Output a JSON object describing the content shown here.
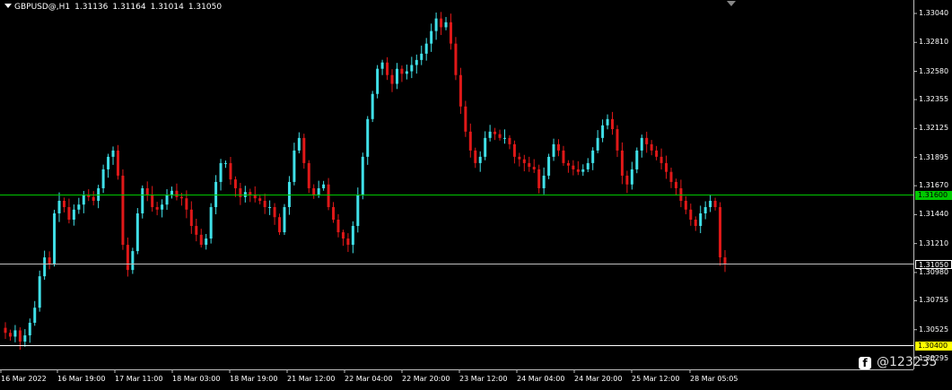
{
  "header": {
    "symbol": "GBPUSD@,H1",
    "open": "1.31136",
    "high": "1.31164",
    "low": "1.31014",
    "close": "1.31050"
  },
  "price_axis": {
    "labels": [
      "1.33040",
      "1.32810",
      "1.32580",
      "1.32355",
      "1.32125",
      "1.31895",
      "1.31670",
      "1.31440",
      "1.31210",
      "1.30980",
      "1.30755",
      "1.30525",
      "1.30295"
    ],
    "tick_values": [
      1.3304,
      1.3281,
      1.3258,
      1.32355,
      1.32125,
      1.31895,
      1.3167,
      1.3144,
      1.3121,
      1.3098,
      1.30755,
      1.30525,
      1.30295
    ]
  },
  "horizontal_lines": [
    {
      "label": "1.31600",
      "value": 1.316,
      "line_color": "#00c800",
      "tag_color": "#00c800"
    },
    {
      "label": "1.31050",
      "value": 1.3105,
      "line_color": "#c0c0c0",
      "tag_color": "#000000"
    },
    {
      "label": "1.30400",
      "value": 1.304,
      "line_color": "#ffffff",
      "tag_color": "#ffff00"
    }
  ],
  "time_axis": {
    "labels": [
      "16 Mar 2022",
      "16 Mar 19:00",
      "17 Mar 11:00",
      "18 Mar 03:00",
      "18 Mar 19:00",
      "21 Mar 12:00",
      "22 Mar 04:00",
      "22 Mar 20:00",
      "23 Mar 12:00",
      "24 Mar 04:00",
      "24 Mar 20:00",
      "25 Mar 12:00",
      "28 Mar 05:05"
    ]
  },
  "colors": {
    "background": "#000000",
    "bull_candle": "#40e0e8",
    "bear_candle": "#e01818",
    "axis": "#c0c0c0"
  },
  "watermark": {
    "icon": "facebook-icon",
    "text": "@123235"
  },
  "chart_data": {
    "type": "candlestick",
    "title": "GBPUSD@,H1",
    "ylim": [
      1.302,
      1.331
    ],
    "close_trajectory": [
      1.305,
      1.3047,
      1.3052,
      1.3043,
      1.3048,
      1.3058,
      1.307,
      1.3095,
      1.311,
      1.3105,
      1.3145,
      1.3155,
      1.315,
      1.314,
      1.3148,
      1.3152,
      1.316,
      1.3158,
      1.3155,
      1.3165,
      1.318,
      1.319,
      1.3195,
      1.3175,
      1.312,
      1.31,
      1.3115,
      1.3145,
      1.3165,
      1.316,
      1.315,
      1.3148,
      1.3152,
      1.316,
      1.3163,
      1.3158,
      1.3157,
      1.3148,
      1.3135,
      1.3128,
      1.312,
      1.3125,
      1.315,
      1.317,
      1.3185,
      1.3185,
      1.3172,
      1.3165,
      1.3158,
      1.3162,
      1.316,
      1.3157,
      1.3155,
      1.315,
      1.315,
      1.3142,
      1.313,
      1.315,
      1.317,
      1.3195,
      1.3205,
      1.3185,
      1.3165,
      1.316,
      1.3165,
      1.3168,
      1.315,
      1.314,
      1.313,
      1.3125,
      1.312,
      1.3135,
      1.316,
      1.319,
      1.322,
      1.324,
      1.326,
      1.3265,
      1.3255,
      1.3248,
      1.326,
      1.3256,
      1.3258,
      1.3263,
      1.3267,
      1.3272,
      1.328,
      1.329,
      1.33,
      1.3293,
      1.3297,
      1.328,
      1.3255,
      1.323,
      1.321,
      1.3195,
      1.3185,
      1.319,
      1.3205,
      1.321,
      1.3208,
      1.3205,
      1.3205,
      1.32,
      1.319,
      1.3188,
      1.3185,
      1.3182,
      1.318,
      1.3165,
      1.3175,
      1.319,
      1.32,
      1.3195,
      1.3185,
      1.3183,
      1.318,
      1.3178,
      1.318,
      1.3185,
      1.3195,
      1.3205,
      1.3215,
      1.322,
      1.3212,
      1.3195,
      1.3175,
      1.3168,
      1.318,
      1.3195,
      1.3205,
      1.32,
      1.3195,
      1.319,
      1.3185,
      1.3178,
      1.317,
      1.3165,
      1.3155,
      1.3148,
      1.314,
      1.3135,
      1.3145,
      1.315,
      1.3155,
      1.315,
      1.311,
      1.3105
    ]
  }
}
